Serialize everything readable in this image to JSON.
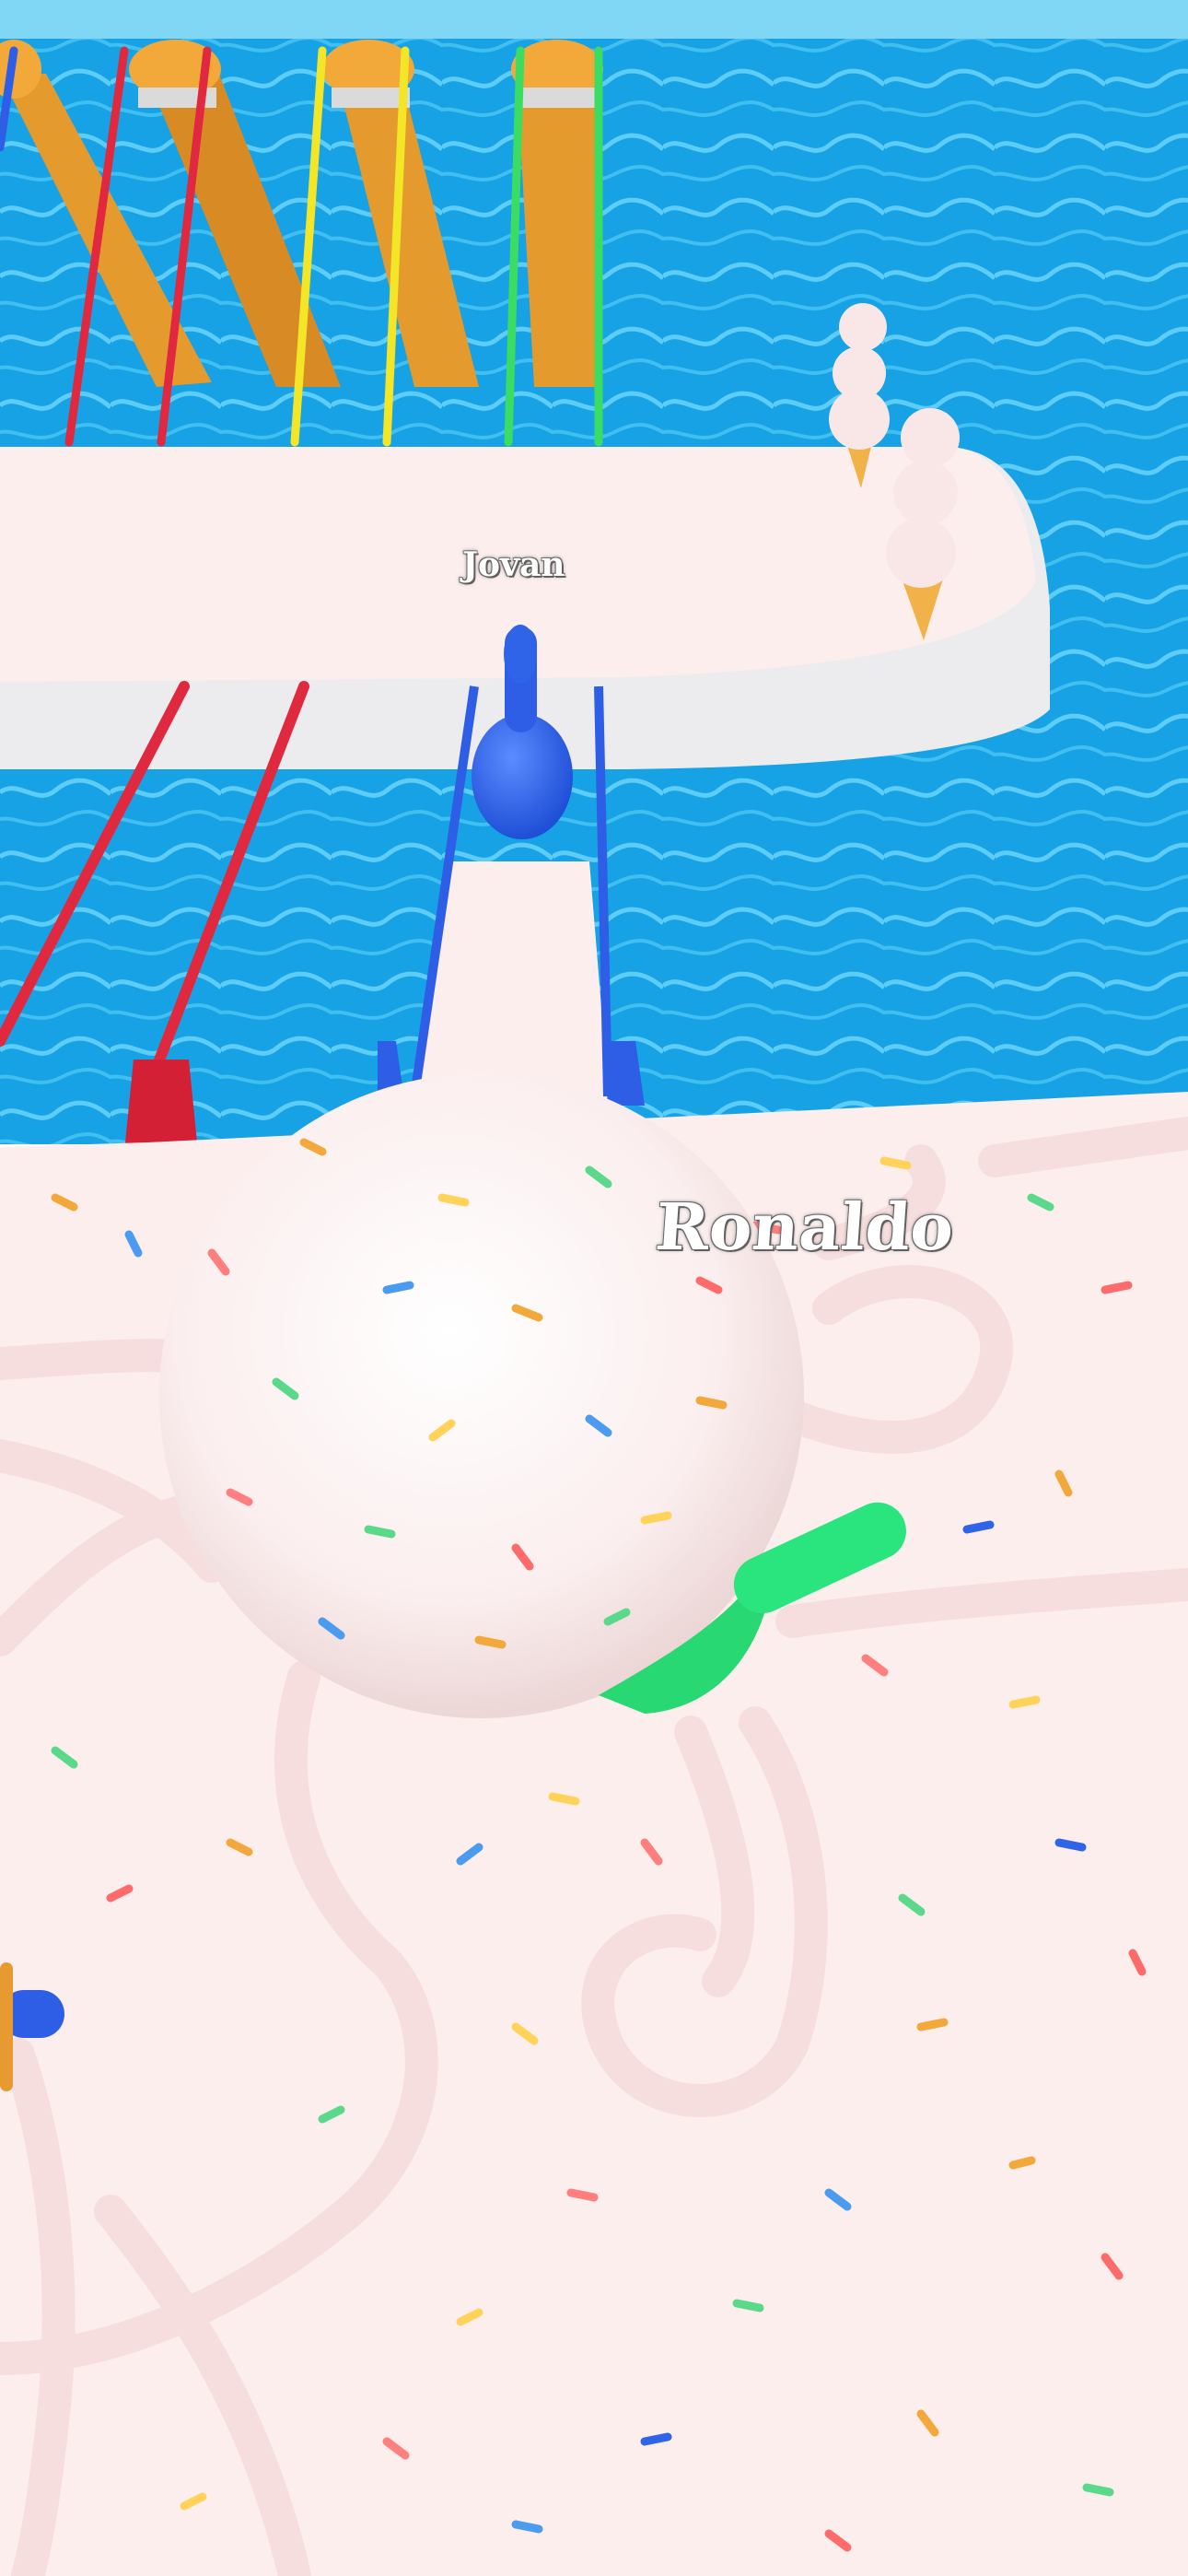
{
  "players": [
    {
      "name": "Jovan",
      "color": "#2f63e8"
    },
    {
      "name": "Ronaldo",
      "color": "#27e07a"
    }
  ],
  "colors": {
    "water": "#1aa6e6",
    "water_light": "#5fd0f7",
    "sky": "#7fd6f5",
    "frosting": "#fbeeed",
    "slide_wood": "#e69a2f",
    "rail_red": "#e0293f",
    "rail_yellow": "#f2e626",
    "rail_green": "#3bdc62",
    "rail_blue": "#2f5ee6"
  },
  "icons": [
    "ice-cream-cone-icon",
    "ice-cream-cone-icon"
  ]
}
